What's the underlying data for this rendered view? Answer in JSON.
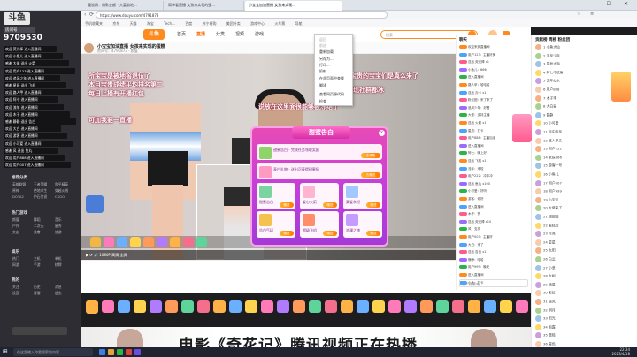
{
  "browser": {
    "tabs": [
      "魔锁网：借款金额（大富翁地...",
      "简单看直播 女孩来实现的蛋...",
      "小宝宝加油直播 女孩来实现..."
    ],
    "url": "https://www.douyu.com/4791873",
    "bookmarks": [
      "手机收藏夹",
      "京东",
      "天猫",
      "淘宝",
      "Tech...",
      "百度",
      "苏宁易购",
      "美团外卖",
      "游戏中心",
      "火车票",
      "导航"
    ],
    "window_controls": "— ☐ ✕"
  },
  "site": {
    "logo": "斗鱼",
    "nav": [
      "首页",
      "直播",
      "分类",
      "视频",
      "游戏",
      "..."
    ],
    "search_placeholder": "搜索",
    "room_title": "小宝宝加油直播 女孩来实现的蛋糕",
    "room_sub": "房间号：4791873 · 颜值"
  },
  "video": {
    "overlays": [
      "所宝宝是被地窖退伍了",
      "本月宝贵成绩平均排名第二",
      "每日上播有开播红包",
      "可加我要一直播",
      "所以宝贵的宝宝们是真么来了",
      "说放在这里面很能够被冻结了",
      "发现社群都冰"
    ],
    "controls": "▶  ⟳  🔊     1080P  高清  全屏"
  },
  "popup": {
    "title": "甜蜜告白",
    "close": "×",
    "row1_label": "甜蜜告白 · 完成任务领取奖励",
    "row1_btn": "去领取",
    "row2_label": "表白礼物 · 送出可获得甜蜜值",
    "row2_btn": "去赠送",
    "cards": [
      "甜蜜告白",
      "爱心火箭",
      "真爱永恒",
      "告白气球",
      "超级飞机",
      "浪漫之旅"
    ],
    "card_btn": "赠送"
  },
  "context_menu": {
    "items": [
      "返回",
      "前进",
      "重新加载",
      "另存为...",
      "打印...",
      "投射...",
      "在此页面中查找",
      "翻译",
      "查看网页源代码",
      "检查"
    ]
  },
  "chat": {
    "lines": [
      "欢迎来到直播间",
      "用户123：主播好美",
      "送出 荧光棒 x1",
      "小鱼儿：666",
      "进入直播间",
      "路人甲：哈哈哈",
      "送出 办卡 x1",
      "粉丝团：来了来了",
      "追风少年：好看",
      "大佬：支持主播",
      "送出 火箭 x1",
      "星辰：打卡",
      "用户888：主播加油",
      "进入直播间",
      "阿七：晚上好",
      "送出 飞机 x1",
      "流年：来啦",
      "用户222：冲冲冲",
      "送出 鱼丸 x100",
      "小可爱：好听",
      "游客：你好",
      "进入直播间",
      "木子：赞",
      "送出 荧光棒 x10",
      "风：支持",
      "用户007：主播好",
      "大白：来了",
      "送出 告白 x1",
      "静静：哈哈",
      "用户999：晚安",
      "进入直播间",
      "小鱼：打卡"
    ],
    "input_placeholder": "发个弹幕吧"
  },
  "rightcol": {
    "header": "贡献榜  周榜  粉丝团",
    "items": [
      "1 小鱼大仙",
      "2 追风少年",
      "3 星辰大海",
      "4 阿七不吃鱼",
      "5 流年似水",
      "6 用户888",
      "7 木子李",
      "8 大白鲨",
      "9 静静",
      "10 小可爱",
      "11 风中追风",
      "12 路人甲乙",
      "13 用户222",
      "14 老铁666",
      "15 游客一号",
      "16 小鱼儿",
      "17 用户007",
      "18 用户999",
      "19 小宝贝",
      "20 大佬来了",
      "21 甜甜圈",
      "22 蛋糕控",
      "23 月亮",
      "24 星星",
      "25 太阳",
      "26 白云",
      "27 小草",
      "28 大树",
      "29 流星",
      "30 彩虹",
      "31 清风",
      "32 明月",
      "33 阳光",
      "34 雨露",
      "35 晨曦",
      "36 暮色"
    ]
  },
  "sidebar": {
    "logo": "斗鱼",
    "count_label": "房间号",
    "count": "9709530",
    "messages": [
      "欢迎 荧光棒 进入直播间",
      "欢迎 小鱼儿 进入直播间",
      "感谢 大佬 送出 火箭",
      "欢迎 用户123 进入直播间",
      "欢迎 追风少年 进入直播间",
      "感谢 星辰 送出 飞机",
      "欢迎 路人甲 进入直播间",
      "欢迎 阿七 进入直播间",
      "欢迎 流年 进入直播间",
      "欢迎 木子 进入直播间",
      "感谢 静静 送出 告白",
      "欢迎 大白 进入直播间",
      "欢迎 游客 进入直播间",
      "欢迎 小可爱 进入直播间",
      "感谢 风 送出 鱼丸",
      "欢迎 用户888 进入直播间",
      "欢迎 用户007 进入直播间"
    ],
    "sections": [
      "推荐分类",
      "热门游戏",
      "娱乐",
      "我的"
    ],
    "grid1": [
      "英雄联盟",
      "王者荣耀",
      "和平精英",
      "原神",
      "绝地求生",
      "穿越火线",
      "DOTA2",
      "炉石传说",
      "CSGO"
    ],
    "grid2": [
      "颜值",
      "舞蹈",
      "音乐",
      "户外",
      "二次元",
      "星秀",
      "交友",
      "美食",
      "旅游"
    ],
    "grid3": [
      "热门",
      "主机",
      "单机",
      "网游",
      "手游",
      "棋牌"
    ],
    "grid4": [
      "关注",
      "历史",
      "消息",
      "设置",
      "客服",
      "退出"
    ]
  },
  "banner": {
    "text": "电影《奇花记》腾讯视频正在热播"
  },
  "taskbar": {
    "search": "在这里输入你要搜索的内容",
    "time": "22:34",
    "date": "2023/4/18"
  },
  "colors": {
    "accent": "#ff6a00",
    "popup": "#c43fd8",
    "sidebar": "#2d2d33"
  }
}
